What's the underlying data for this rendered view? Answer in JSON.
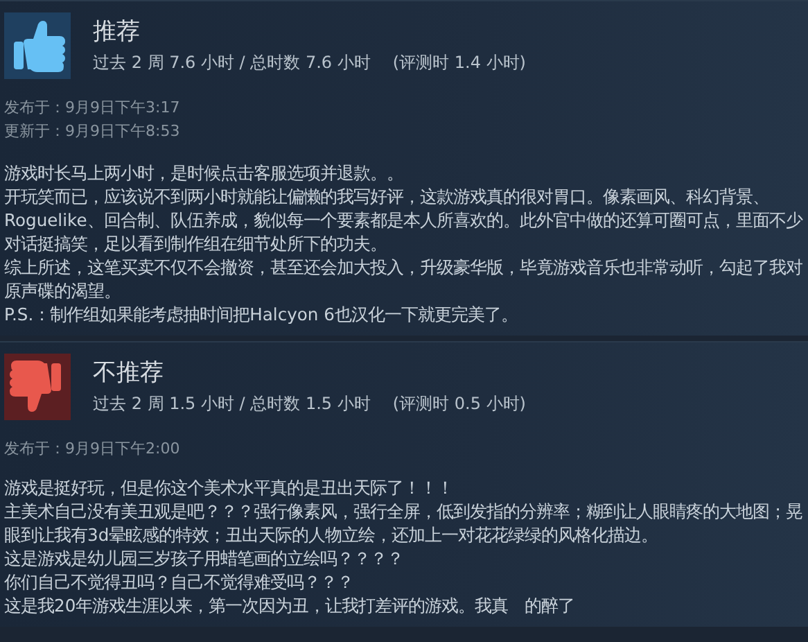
{
  "reviews": [
    {
      "recommended": true,
      "verdict": "推荐",
      "hours": "过去 2 周 7.6 小时 / 总时数 7.6 小时",
      "review_time": "(评测时 1.4 小时)",
      "dates": [
        "发布于：9月9日下午3:17",
        "更新于：9月9日下午8:53"
      ],
      "paragraphs": [
        "游戏时长马上两小时，是时候点击客服选项并退款。。",
        "开玩笑而已，应该说不到两小时就能让偏懒的我写好评，这款游戏真的很对胃口。像素画风、科幻背景、Roguelike、回合制、队伍养成，貌似每一个要素都是本人所喜欢的。此外官中做的还算可圈可点，里面不少对话挺搞笑，足以看到制作组在细节处所下的功夫。",
        "综上所述，这笔买卖不仅不会撤资，甚至还会加大投入，升级豪华版，毕竟游戏音乐也非常动听，勾起了我对原声碟的渴望。",
        "P.S.：制作组如果能考虑抽时间把Halcyon 6也汉化一下就更完美了。"
      ]
    },
    {
      "recommended": false,
      "verdict": "不推荐",
      "hours": "过去 2 周 1.5 小时 / 总时数 1.5 小时",
      "review_time": "(评测时 0.5 小时)",
      "dates": [
        "发布于：9月9日下午2:00"
      ],
      "paragraphs": [
        "游戏是挺好玩，但是你这个美术水平真的是丑出天际了！！！",
        "主美术自己没有美丑观是吧？？？强行像素风，强行全屏，低到发指的分辨率；糊到让人眼睛疼的大地图；晃眼到让我有3d晕眩感的特效；丑出天际的人物立绘，还加上一对花花绿绿的风格化描边。",
        "这是游戏是幼儿园三岁孩子用蜡笔画的立绘吗？？？？",
        "你们自己不觉得丑吗？自己不觉得难受吗？？？",
        "这是我20年游戏生涯以来，第一次因为丑，让我打差评的游戏。我真　的醉了"
      ]
    }
  ]
}
